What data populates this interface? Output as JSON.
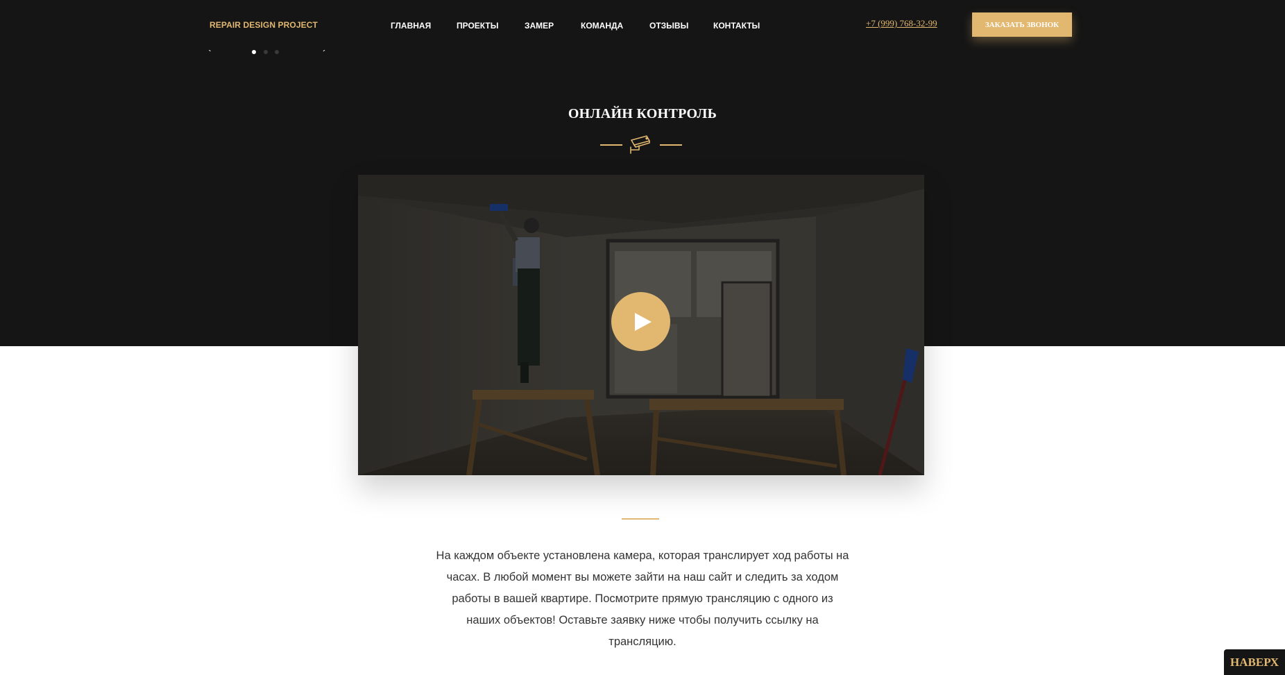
{
  "header": {
    "logo": "REPAIR DESIGN PROJECT",
    "nav": [
      {
        "label": "ГЛАВНАЯ"
      },
      {
        "label": "ПРОЕКТЫ"
      },
      {
        "label": "ЗАМЕР"
      },
      {
        "label": "КОМАНДА"
      },
      {
        "label": "ОТЗЫВЫ"
      },
      {
        "label": "КОНТАКТЫ"
      }
    ],
    "phone": "+7 (999) 768-32-99",
    "callback_label": "ЗАКАЗАТЬ ЗВОНОК"
  },
  "slider": {
    "prev_icon": "chevron-left-icon",
    "next_icon": "chevron-right-icon",
    "dots_count": 3,
    "active_dot": 1
  },
  "section": {
    "title": "ОНЛАЙН КОНТРОЛЬ",
    "icon": "security-camera-icon",
    "video_play_icon": "play-icon",
    "description": "На каждом объекте установлена камера, которая транслирует ход работы на часах. В любой момент вы можете зайти на наш сайт и следить за ходом работы в вашей квартире. Посмотрите прямую трансляцию с одного из наших объектов! Оставьте заявку ниже чтобы получить ссылку на трансляцию."
  },
  "to_top_label": "НАВЕРХ",
  "colors": {
    "accent": "#e2b870",
    "dark": "#151515",
    "text": "#333333"
  }
}
